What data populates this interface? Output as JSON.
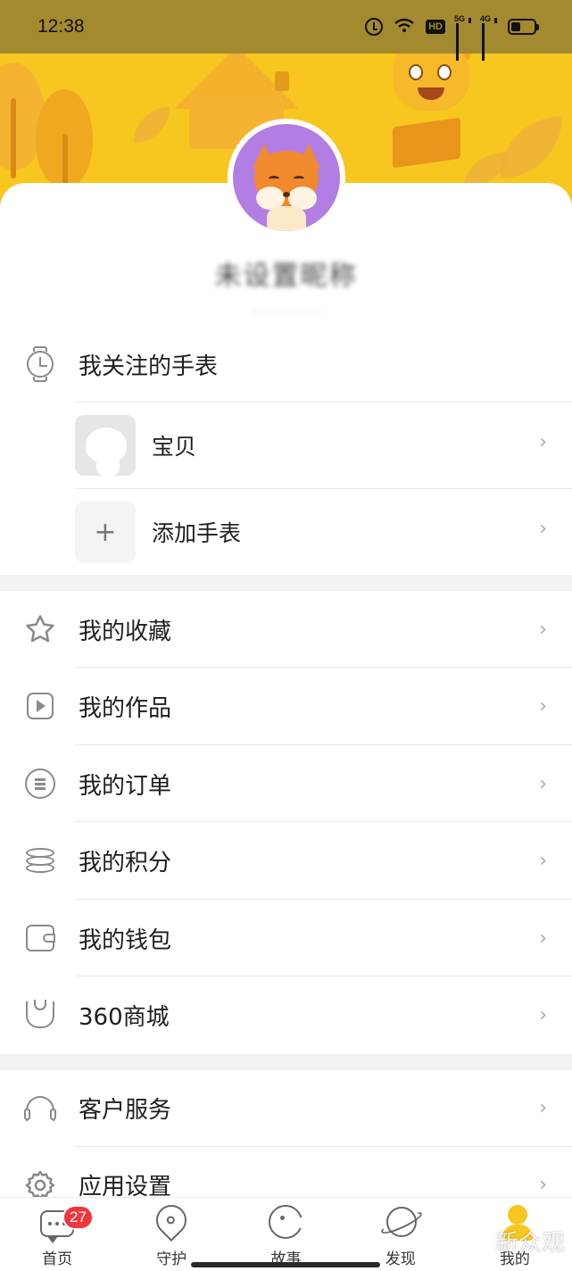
{
  "status_bar": {
    "time": "12:38",
    "hd_label": "HD",
    "sig1_label": "5G",
    "sig2_label": "4G"
  },
  "profile": {
    "nickname": "未设置昵称",
    "subline": "·············"
  },
  "watch_section": {
    "title": "我关注的手表",
    "items": [
      {
        "label": "宝贝"
      },
      {
        "label": "添加手表"
      }
    ],
    "add_symbol": "+"
  },
  "menu_group_1": [
    {
      "label": "我的收藏"
    },
    {
      "label": "我的作品"
    },
    {
      "label": "我的订单"
    },
    {
      "label": "我的积分"
    },
    {
      "label": "我的钱包"
    },
    {
      "label": "360商城"
    }
  ],
  "menu_group_2": [
    {
      "label": "客户服务"
    },
    {
      "label": "应用设置"
    }
  ],
  "chevron": "›",
  "tabbar": {
    "tabs": [
      {
        "label": "首页",
        "badge": "27"
      },
      {
        "label": "守护"
      },
      {
        "label": "故事"
      },
      {
        "label": "发现"
      },
      {
        "label": "我的"
      }
    ]
  },
  "watermark": "新众观",
  "colors": {
    "banner": "#f7c71f",
    "badge": "#f2343c",
    "avatar_bg": "#b27ee4"
  }
}
